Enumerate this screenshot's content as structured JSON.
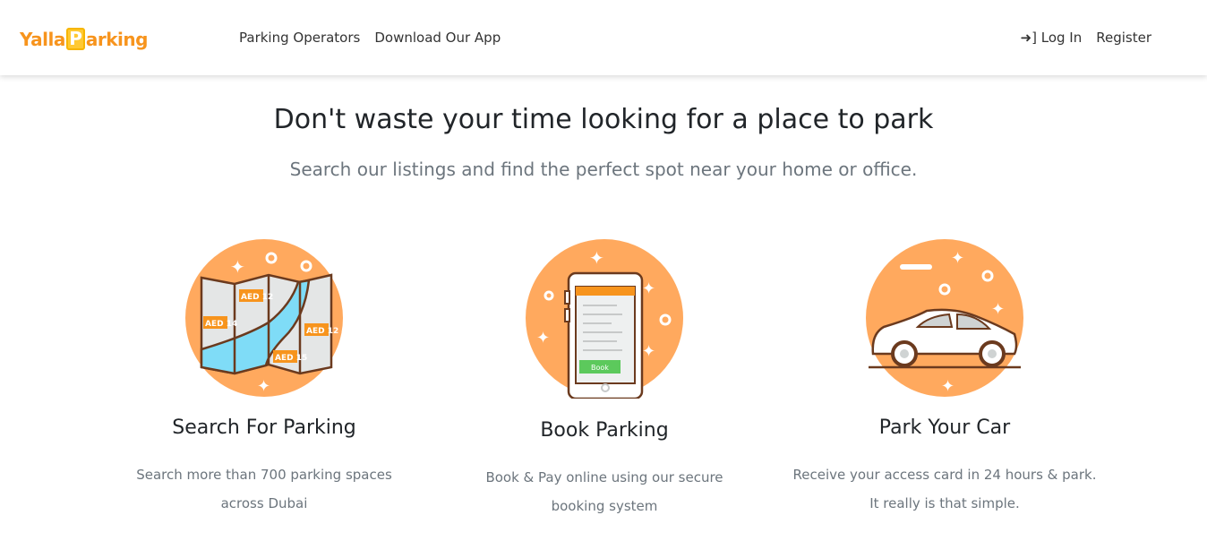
{
  "nav": {
    "logo": {
      "part1": "Yalla",
      "p": "P",
      "part2": "arking"
    },
    "links": [
      "Parking Operators",
      "Download Our App"
    ],
    "login": "Log In",
    "register": "Register"
  },
  "hero": {
    "title": "Don't waste your time looking for a place to park",
    "subtitle": "Search our listings and find the perfect spot near your home or office."
  },
  "features": [
    {
      "title": "Search For Parking",
      "desc1": "Search more than 700 parking spaces",
      "desc2": "across Dubai",
      "tags": [
        "AED 12",
        "AED 14",
        "AED 12",
        "AED 15"
      ]
    },
    {
      "title": "Book Parking",
      "desc1": "Book & Pay online using our secure",
      "desc2": "booking system",
      "button": "Book"
    },
    {
      "title": "Park Your Car",
      "desc1": "Receive your access card in 24 hours & park.",
      "desc2": "It really is that simple."
    }
  ],
  "colors": {
    "orange": "#ffa95e",
    "brand": "#f7941d",
    "outline": "#6b3a1e"
  }
}
